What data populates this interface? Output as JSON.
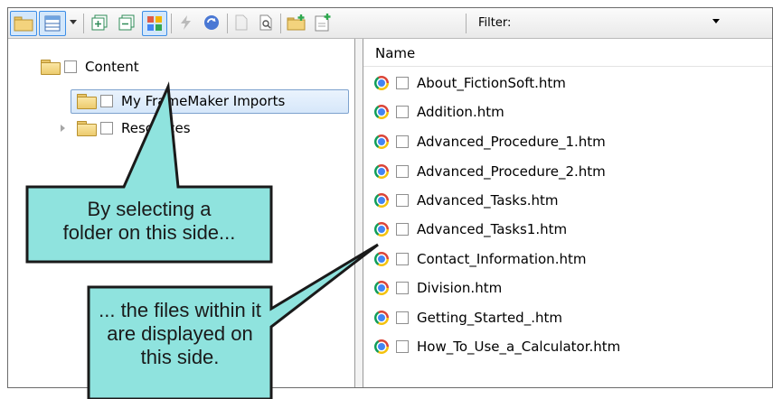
{
  "toolbar": {
    "filter_label": "Filter:",
    "filter_value": "",
    "icons": [
      "folder-open-icon",
      "view-layout-icon",
      "dropdown-arrow-icon",
      "expand-all-icon",
      "collapse-all-icon",
      "show-all-icon",
      "bolt-icon",
      "sync-icon",
      "document-icon",
      "search-document-icon",
      "new-folder-icon",
      "new-file-icon"
    ]
  },
  "tree": {
    "items": [
      {
        "label": "Content"
      },
      {
        "label": "My FrameMaker Imports"
      },
      {
        "label": "Resources"
      }
    ]
  },
  "files": {
    "column_header": "Name",
    "items": [
      {
        "name": "About_FictionSoft.htm"
      },
      {
        "name": "Addition.htm"
      },
      {
        "name": "Advanced_Procedure_1.htm"
      },
      {
        "name": "Advanced_Procedure_2.htm"
      },
      {
        "name": "Advanced_Tasks.htm"
      },
      {
        "name": "Advanced_Tasks1.htm"
      },
      {
        "name": "Contact_Information.htm"
      },
      {
        "name": "Division.htm"
      },
      {
        "name": "Getting_Started_.htm"
      },
      {
        "name": "How_To_Use_a_Calculator.htm"
      }
    ]
  },
  "callouts": {
    "first": {
      "line1": "By selecting a",
      "line2": "folder on this side..."
    },
    "second": {
      "line1": "... the files within it",
      "line2": "are displayed on",
      "line3": "this side."
    }
  },
  "colors": {
    "callout_fill": "#8fe3de",
    "callout_border": "#1a1a1a",
    "selection_border": "#7da2ce"
  }
}
